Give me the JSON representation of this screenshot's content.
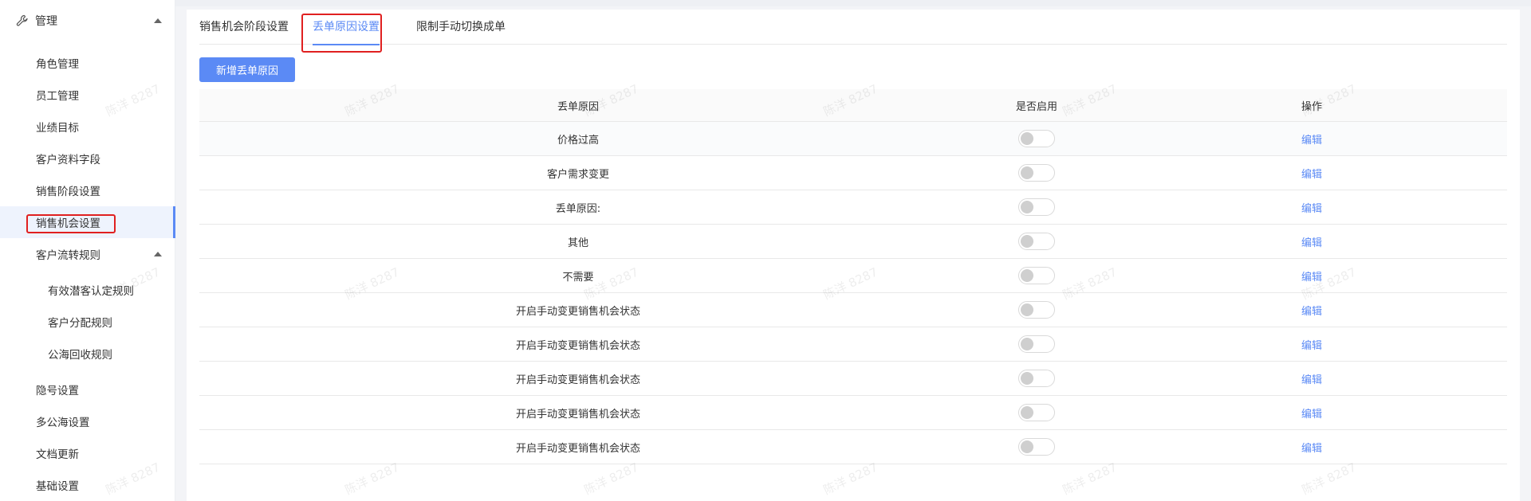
{
  "sidebar": {
    "header": {
      "label": "管理",
      "icon": "wrench-icon"
    },
    "items": [
      {
        "label": "角色管理",
        "level": 1
      },
      {
        "label": "员工管理",
        "level": 1
      },
      {
        "label": "业绩目标",
        "level": 1
      },
      {
        "label": "客户资料字段",
        "level": 1
      },
      {
        "label": "销售阶段设置",
        "level": 1
      },
      {
        "label": "销售机会设置",
        "level": 1,
        "active": true
      },
      {
        "label": "客户流转规则",
        "level": 1,
        "expanded": true
      },
      {
        "label": "有效潜客认定规则",
        "level": 2
      },
      {
        "label": "客户分配规则",
        "level": 2
      },
      {
        "label": "公海回收规则",
        "level": 2
      },
      {
        "label": "隐号设置",
        "level": 1
      },
      {
        "label": "多公海设置",
        "level": 1
      },
      {
        "label": "文档更新",
        "level": 1
      },
      {
        "label": "基础设置",
        "level": 1
      }
    ]
  },
  "tabs": [
    {
      "label": "销售机会阶段设置"
    },
    {
      "label": "丢单原因设置",
      "active": true
    },
    {
      "label": "限制手动切换成单"
    }
  ],
  "toolbar": {
    "add_label": "新增丢单原因"
  },
  "table": {
    "columns": [
      "丢单原因",
      "是否启用",
      "操作"
    ],
    "rows": [
      {
        "reason": "价格过高",
        "enabled": false,
        "action": "编辑"
      },
      {
        "reason": "客户需求变更",
        "enabled": false,
        "action": "编辑"
      },
      {
        "reason": "丢单原因:",
        "enabled": false,
        "action": "编辑"
      },
      {
        "reason": "其他",
        "enabled": false,
        "action": "编辑"
      },
      {
        "reason": "不需要",
        "enabled": false,
        "action": "编辑"
      },
      {
        "reason": "开启手动变更销售机会状态",
        "enabled": false,
        "action": "编辑"
      },
      {
        "reason": "开启手动变更销售机会状态",
        "enabled": false,
        "action": "编辑"
      },
      {
        "reason": "开启手动变更销售机会状态",
        "enabled": false,
        "action": "编辑"
      },
      {
        "reason": "开启手动变更销售机会状态",
        "enabled": false,
        "action": "编辑"
      },
      {
        "reason": "开启手动变更销售机会状态",
        "enabled": false,
        "action": "编辑"
      }
    ]
  },
  "watermark": "陈洋 8287",
  "colors": {
    "accent": "#5b8af5",
    "highlight_box": "#e02020"
  }
}
